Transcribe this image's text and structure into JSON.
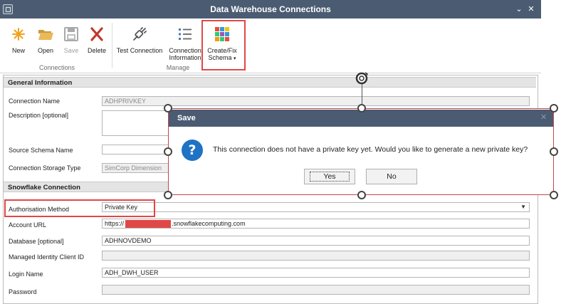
{
  "window": {
    "title": "Data Warehouse Connections",
    "controls": [
      "⌄",
      "✕"
    ]
  },
  "ribbon": {
    "buttons": {
      "new": "New",
      "open": "Open",
      "save": "Save",
      "delete": "Delete",
      "test": "Test Connection",
      "info_line1": "Connection",
      "info_line2": "Information",
      "schema_line1": "Create/Fix",
      "schema_line2": "Schema"
    },
    "groups": {
      "connections": "Connections",
      "manage": "Manage"
    }
  },
  "general": {
    "header": "General Information",
    "connection_name_label": "Connection Name",
    "connection_name_value": "ADHPRIVKEY",
    "description_label": "Description [optional]",
    "description_value": "",
    "source_schema_label": "Source Schema Name",
    "source_schema_value": "",
    "storage_type_label": "Connection Storage Type",
    "storage_type_value": "SimCorp Dimension"
  },
  "snowflake": {
    "header": "Snowflake Connection",
    "auth_label": "Authorisation Method",
    "auth_value": "Private Key",
    "account_url_label": "Account URL",
    "account_url_prefix": "https://",
    "account_url_suffix": ".snowflakecomputing.com",
    "database_label": "Database [optional]",
    "database_value": "ADHNOVDEMO",
    "managed_identity_label": "Managed Identity Client ID",
    "managed_identity_value": "",
    "login_label": "Login Name",
    "login_value": "ADH_DWH_USER",
    "password_label": "Password",
    "password_value": ""
  },
  "dialog": {
    "title": "Save",
    "close": "✕",
    "message": "This connection does not have a private key yet. Would you like to generate a new private key?",
    "yes": "Yes",
    "no": "No"
  },
  "colors": {
    "titlebar": "#4b5c72",
    "highlight": "#e04747",
    "info_icon": "#1f72c4",
    "new_icon": "#f0a21a",
    "delete_icon": "#c0392b"
  }
}
